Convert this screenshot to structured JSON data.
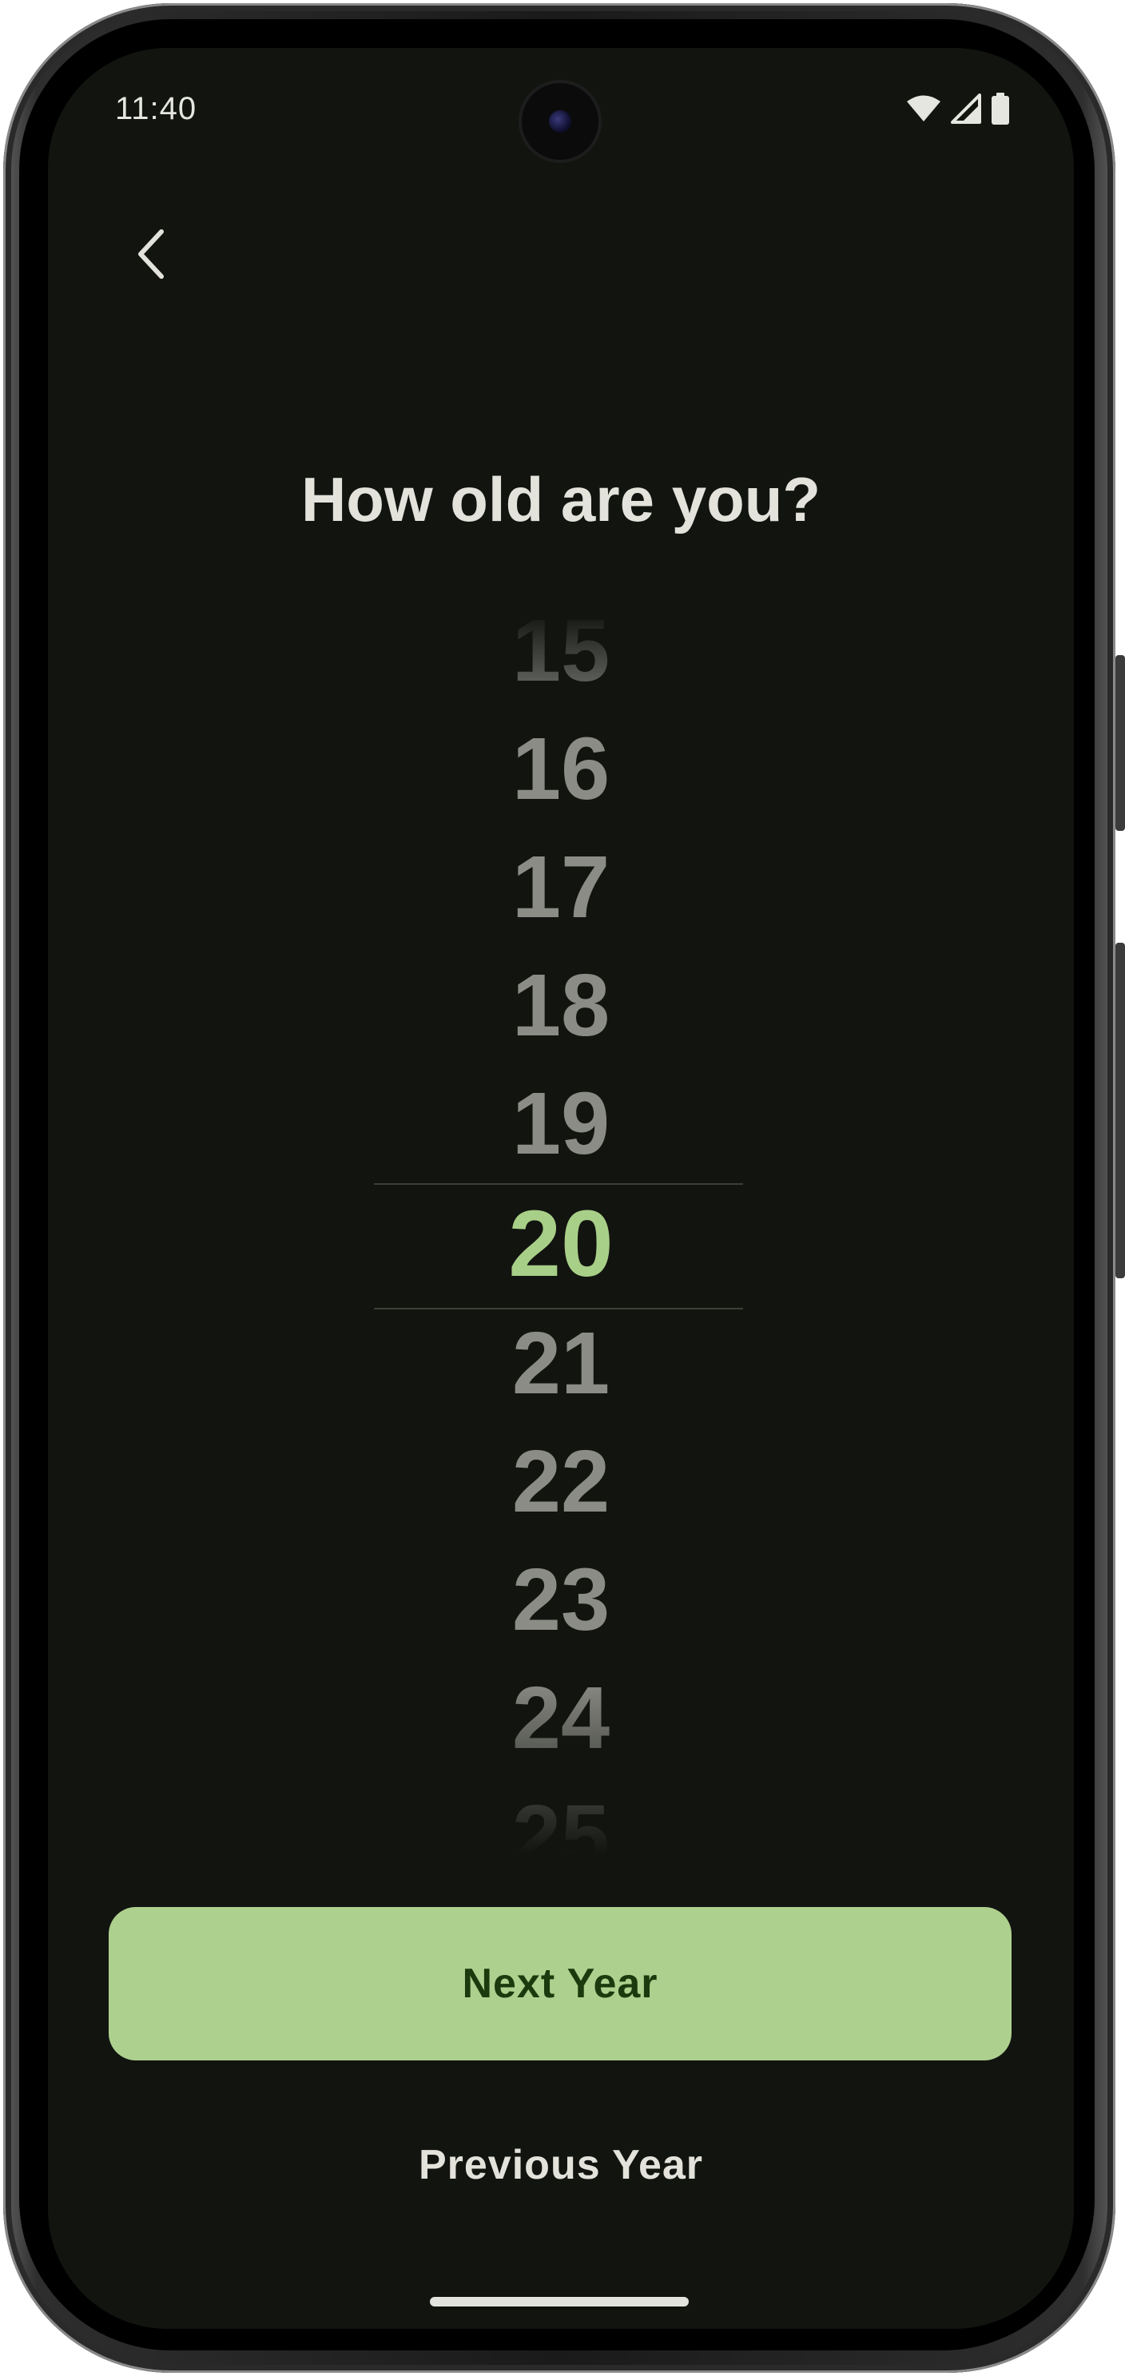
{
  "status_bar": {
    "time": "11:40",
    "icons": [
      "wifi-icon",
      "cellular-signal-icon",
      "battery-icon"
    ]
  },
  "nav": {
    "back_icon": "chevron-left-icon"
  },
  "page": {
    "title": "How old are you?"
  },
  "age_picker": {
    "items": [
      "15",
      "16",
      "17",
      "18",
      "19",
      "20",
      "21",
      "22",
      "23",
      "24",
      "25"
    ],
    "selected": "20",
    "selected_color": "#a8cf87"
  },
  "actions": {
    "next_label": "Next Year",
    "previous_label": "Previous Year"
  },
  "colors": {
    "background": "#121410",
    "accent": "#aed08e",
    "accent_text": "#1b3a0d"
  }
}
